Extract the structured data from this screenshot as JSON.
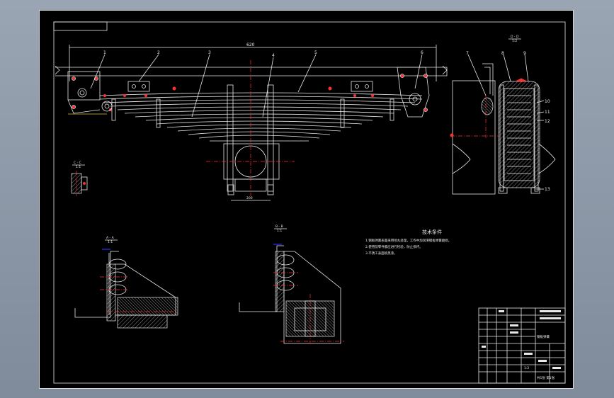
{
  "drawing": {
    "overall_length": "620",
    "clamp_width": "200",
    "section_dd_label": "D - D",
    "section_dd_scale": "1:2",
    "section_cc_label": "C - C",
    "section_cc_scale": "1:1",
    "section_aa_label": "A - A",
    "section_aa_scale": "1:1",
    "section_bb_label": "B - B",
    "section_bb_scale": "1:1",
    "part_numbers": [
      "1",
      "2",
      "3",
      "4",
      "5",
      "6",
      "7",
      "8",
      "9",
      "10",
      "11",
      "12",
      "13"
    ]
  },
  "notes": {
    "title": "技术条件",
    "items": [
      "1.钢板弹簧表面采用喷丸处理，工作中加润滑钢板弹簧磨损。",
      "2.使用前零件都应进行检验，防止损坏。",
      "3.不锈工表面喷黑漆。"
    ]
  },
  "title_block": {
    "drawing_title": "钢板弹簧",
    "scale": "1:2",
    "sheet": "共1张 第1张"
  }
}
